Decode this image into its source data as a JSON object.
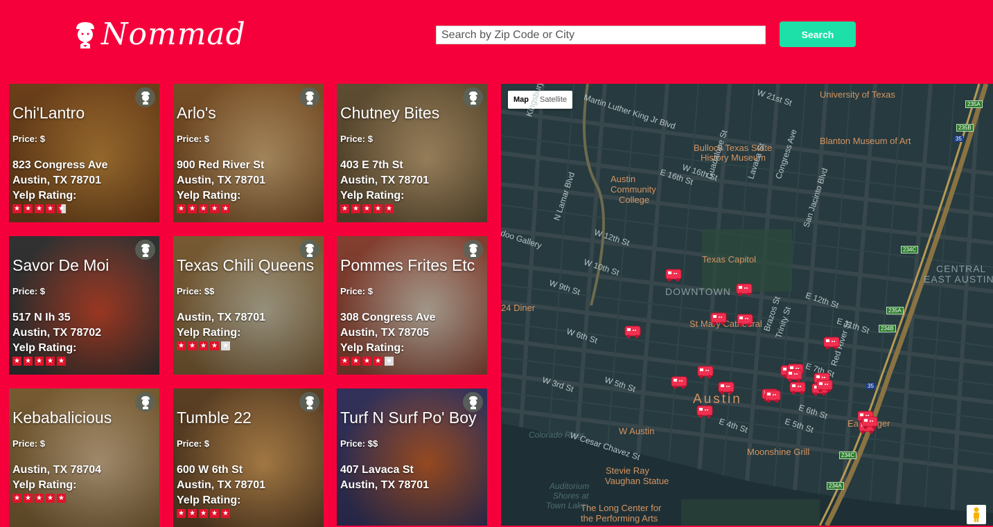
{
  "brand": {
    "name": "Nommad"
  },
  "search": {
    "placeholder": "Search by Zip Code or City",
    "value": "",
    "button_label": "Search"
  },
  "cards": [
    {
      "name": "Chi'Lantro",
      "price": "Price: $",
      "lines": [
        "823 Congress Ave",
        "Austin, TX 78701",
        "Yelp Rating:"
      ],
      "stars": 4.5,
      "colors": [
        "#c68a3b",
        "#7d4a1e"
      ]
    },
    {
      "name": "Arlo's",
      "price": "Price: $",
      "lines": [
        "900 Red River St",
        "Austin, TX 78701",
        "Yelp Rating:"
      ],
      "stars": 5,
      "colors": [
        "#d9b27a",
        "#8a5a2c"
      ]
    },
    {
      "name": "Chutney Bites",
      "price": "Price: $",
      "lines": [
        "403 E 7th St",
        "Austin, TX 78701",
        "Yelp Rating:"
      ],
      "stars": 5,
      "colors": [
        "#c9a878",
        "#6e5a3a"
      ]
    },
    {
      "name": "Savor De Moi",
      "price": "Price: $",
      "lines": [
        "517 N Ih 35",
        "Austin, TX 78702",
        "Yelp Rating:"
      ],
      "stars": 5,
      "colors": [
        "#cf4a2d",
        "#3a3a3a"
      ]
    },
    {
      "name": "Texas Chili Queens",
      "price": "Price: $$",
      "lines": [
        "Austin, TX 78701",
        "Yelp Rating:"
      ],
      "stars": 4,
      "colors": [
        "#c9c1a6",
        "#8c6a3c"
      ]
    },
    {
      "name": "Pommes Frites Etc",
      "price": "Price: $",
      "lines": [
        "308 Congress Ave",
        "Austin, TX 78705",
        "Yelp Rating:"
      ],
      "stars": 4,
      "colors": [
        "#d8cbb8",
        "#9a4a38"
      ]
    },
    {
      "name": "Kebabalicious",
      "price": "Price: $",
      "lines": [
        "Austin, TX 78704",
        "Yelp Rating:"
      ],
      "stars": 5,
      "colors": [
        "#d6b890",
        "#8a6a3a"
      ]
    },
    {
      "name": "Tumble 22",
      "price": "Price: $",
      "lines": [
        "600 W 6th St",
        "Austin, TX 78701",
        "Yelp Rating:"
      ],
      "stars": 5,
      "colors": [
        "#d9a05a",
        "#6a4a2a"
      ]
    },
    {
      "name": "Turf N Surf Po' Boy",
      "price": "Price: $$",
      "lines": [
        "407 Lavaca St",
        "Austin, TX 78701"
      ],
      "stars": 0,
      "colors": [
        "#c9622a",
        "#3a3a6a"
      ]
    }
  ],
  "map": {
    "toggle": [
      "Map",
      "Satellite"
    ],
    "labels": [
      {
        "text": "University of Texas",
        "kind": "poi"
      },
      {
        "text": "Blanton Museum of Art",
        "kind": "poi"
      },
      {
        "text": "Bullock Texas State",
        "kind": "poi"
      },
      {
        "text": "History Museum",
        "kind": "poi"
      },
      {
        "text": "Austin",
        "kind": "poi"
      },
      {
        "text": "Community",
        "kind": "poi"
      },
      {
        "text": "College",
        "kind": "poi"
      },
      {
        "text": "doo Gallery",
        "kind": "street"
      },
      {
        "text": "Texas Capitol",
        "kind": "poi"
      },
      {
        "text": "DOWNTOWN",
        "kind": "district"
      },
      {
        "text": "24 Diner",
        "kind": "poi"
      },
      {
        "text": "St Mary Cathedral",
        "kind": "poi"
      },
      {
        "text": "Austin",
        "kind": "big"
      },
      {
        "text": "W Austin",
        "kind": "poi"
      },
      {
        "text": "Moonshine Grill",
        "kind": "poi"
      },
      {
        "text": "Easy Tiger",
        "kind": "poi"
      },
      {
        "text": "Stevie Ray",
        "kind": "poi"
      },
      {
        "text": "Vaughan Statue",
        "kind": "poi"
      },
      {
        "text": "The Long Center for",
        "kind": "poi"
      },
      {
        "text": "the Performing Arts",
        "kind": "poi"
      },
      {
        "text": "Colorado River",
        "kind": "water"
      },
      {
        "text": "Auditorium",
        "kind": "water"
      },
      {
        "text": "Shores at",
        "kind": "water"
      },
      {
        "text": "Town Lake",
        "kind": "water"
      },
      {
        "text": "CENTRAL",
        "kind": "district"
      },
      {
        "text": "EAST AUSTIN",
        "kind": "district"
      },
      {
        "text": "W 21st St",
        "kind": "street"
      },
      {
        "text": "W 16th St",
        "kind": "street"
      },
      {
        "text": "W 12th St",
        "kind": "street"
      },
      {
        "text": "W 10th St",
        "kind": "street"
      },
      {
        "text": "W 9th St",
        "kind": "street"
      },
      {
        "text": "W 6th St",
        "kind": "street"
      },
      {
        "text": "W 5th St",
        "kind": "street"
      },
      {
        "text": "W 3rd St",
        "kind": "street"
      },
      {
        "text": "W Cesar Chavez St",
        "kind": "street"
      },
      {
        "text": "E 12th St",
        "kind": "street"
      },
      {
        "text": "E 11th St",
        "kind": "street"
      },
      {
        "text": "E 7th St",
        "kind": "street"
      },
      {
        "text": "E 6th St",
        "kind": "street"
      },
      {
        "text": "E 5th St",
        "kind": "street"
      },
      {
        "text": "E 4th St",
        "kind": "street"
      },
      {
        "text": "Kingsbury St",
        "kind": "street"
      },
      {
        "text": "N Lamar Blvd",
        "kind": "street"
      },
      {
        "text": "Guadalupe St",
        "kind": "street"
      },
      {
        "text": "Lavaca St",
        "kind": "street"
      },
      {
        "text": "Congress Ave",
        "kind": "street"
      },
      {
        "text": "Brazos St",
        "kind": "street"
      },
      {
        "text": "San Jacinto Blvd",
        "kind": "street"
      },
      {
        "text": "Trinity St",
        "kind": "street"
      },
      {
        "text": "Red River St",
        "kind": "street"
      },
      {
        "text": "Martin Luther King Jr Blvd",
        "kind": "street"
      },
      {
        "text": "E 16th St",
        "kind": "street"
      }
    ],
    "highways": [
      "235A",
      "235B",
      "35",
      "234C",
      "235A",
      "234B",
      "35",
      "234C",
      "234A"
    ],
    "marker_count": 22
  }
}
